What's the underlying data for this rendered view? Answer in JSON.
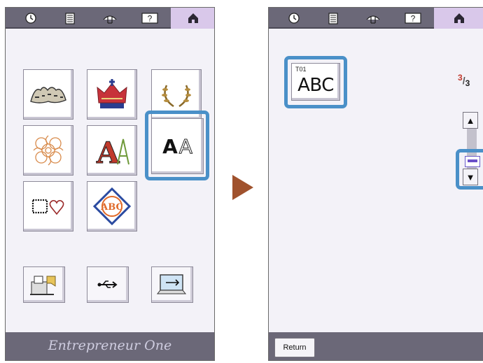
{
  "left_screen": {
    "topbar": {
      "icons": [
        "clock-icon",
        "document-icon",
        "thread-icon",
        "help-icon",
        "home-icon"
      ],
      "active": "home-icon",
      "help_label": "?"
    },
    "pattern_tiles": [
      {
        "name": "king-lettering-pattern"
      },
      {
        "name": "crown-pattern"
      },
      {
        "name": "laurel-wreath-pattern"
      },
      {
        "name": "floral-lace-pattern"
      },
      {
        "name": "decorative-letters-pattern",
        "label": "A"
      },
      {
        "name": "alphabet-fonts-pattern",
        "label_a": "A",
        "label_b": "A",
        "selected": true
      },
      {
        "name": "frames-pattern"
      },
      {
        "name": "monogram-pattern",
        "label": "ABC"
      }
    ],
    "bottom_buttons": [
      {
        "name": "embroidery-machine-button",
        "icon": "machine-memory-icon"
      },
      {
        "name": "usb-button",
        "icon": "usb-icon"
      },
      {
        "name": "computer-button",
        "icon": "computer-usb-icon"
      }
    ],
    "footer_brand": "Entrepreneur One"
  },
  "right_screen": {
    "topbar": {
      "icons": [
        "clock-icon",
        "document-icon",
        "thread-icon",
        "help-icon",
        "home-icon"
      ],
      "active": "home-icon",
      "help_label": "?"
    },
    "font_button": {
      "code": "T01",
      "text": "ABC",
      "selected": true
    },
    "page_indicator": {
      "current": "3",
      "total": "3"
    },
    "scroll": {
      "up_label": "▲",
      "down_label": "▼",
      "position": 1.0
    },
    "return_label": "Return"
  },
  "colors": {
    "highlight": "#4a90c8",
    "topbar": "#6b6878",
    "active_tab": "#d9c8ea",
    "arrow": "#a0522d",
    "screen_bg": "#f3f2f8"
  }
}
